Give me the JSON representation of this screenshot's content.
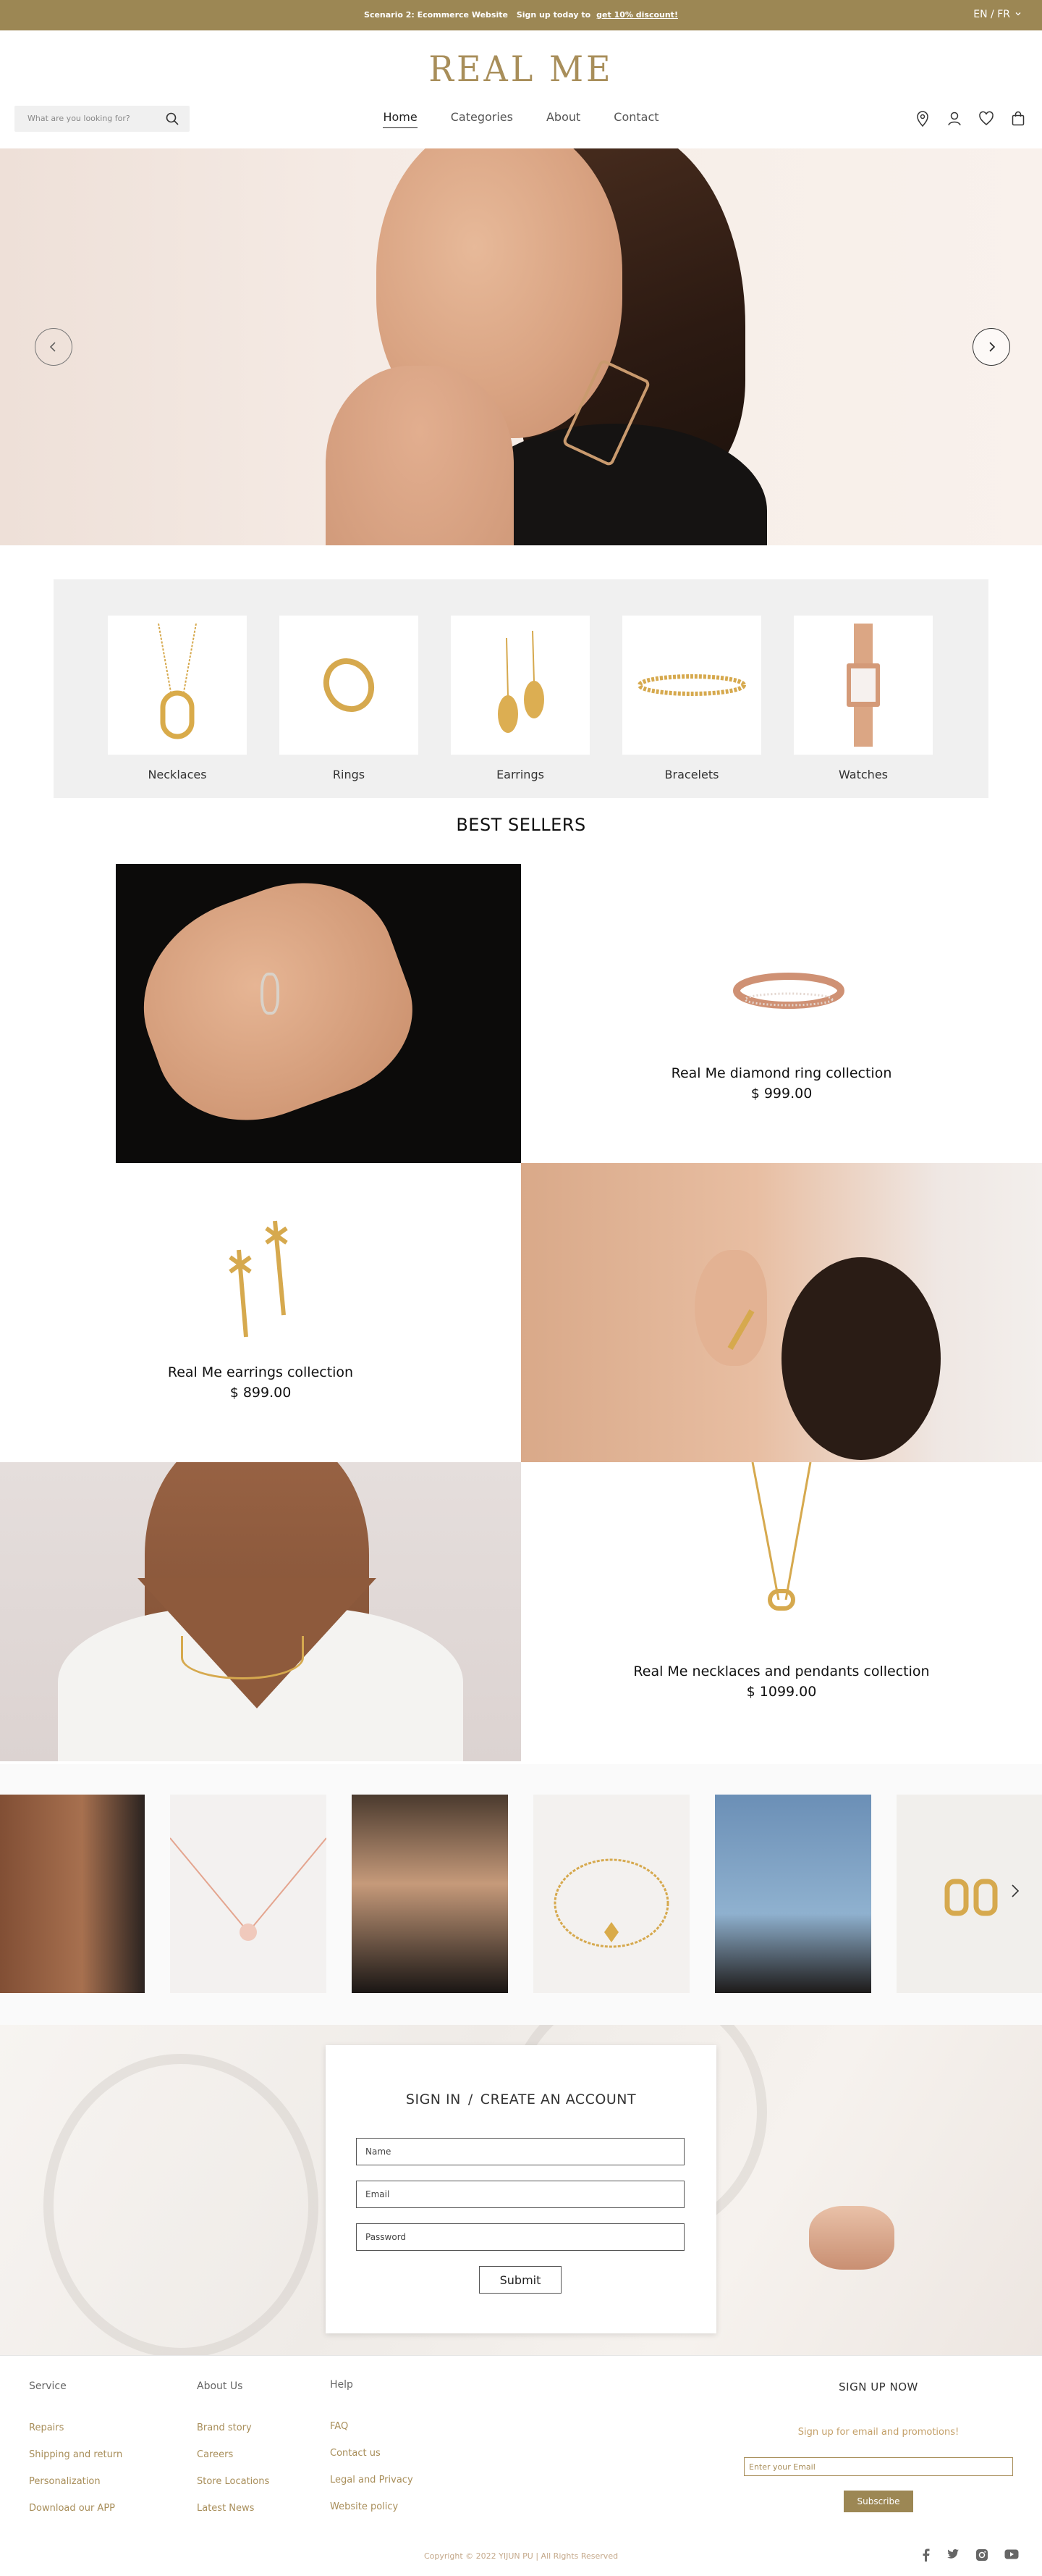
{
  "topbar": {
    "scenario": "Scenario 2: Ecommerce Website",
    "signup_text": "Sign up today to",
    "discount": "get 10% discount!",
    "language": "EN / FR"
  },
  "brand": {
    "logo": "REAL ME"
  },
  "search": {
    "placeholder": "What are you looking for?"
  },
  "nav": {
    "items": [
      "Home",
      "Categories",
      "About",
      "Contact"
    ],
    "active": "Home"
  },
  "categories": [
    "Necklaces",
    "Rings",
    "Earrings",
    "Bracelets",
    "Watches"
  ],
  "best_sellers": {
    "title": "BEST SELLERS",
    "items": [
      {
        "name": "Real Me diamond ring collection",
        "price": "$ 999.00"
      },
      {
        "name": "Real Me earrings collection",
        "price": "$ 899.00"
      },
      {
        "name": "Real Me necklaces and pendants collection",
        "price": "$ 1099.00"
      }
    ]
  },
  "account": {
    "sign_in": "SIGN IN",
    "separator": "/",
    "create": "CREATE AN ACCOUNT",
    "name_placeholder": "Name",
    "email_placeholder": "Email",
    "password_placeholder": "Password",
    "submit": "Submit"
  },
  "footer": {
    "service": {
      "heading": "Service",
      "links": [
        "Repairs",
        "Shipping and return",
        "Personalization",
        "Download our APP"
      ]
    },
    "about": {
      "heading": "About Us",
      "links": [
        "Brand story",
        "Careers",
        "Store Locations",
        "Latest News"
      ]
    },
    "help": {
      "heading": "Help",
      "links": [
        "FAQ",
        "Contact us",
        "Legal and Privacy",
        "Website policy"
      ]
    },
    "signup": {
      "heading": "SIGN UP NOW",
      "subtext": "Sign up for email and promotions!",
      "email_placeholder": "Enter your Email",
      "button": "Subscribe"
    },
    "copyright": "Copyright © 2022 YIJUN PU | All Rights Reserved",
    "social_icons": [
      "facebook-icon",
      "twitter-icon",
      "instagram-icon",
      "youtube-icon"
    ]
  },
  "colors": {
    "brand_gold": "#9c8754",
    "logo_gold": "#a88e5a",
    "link_gold": "#a88e5a"
  }
}
